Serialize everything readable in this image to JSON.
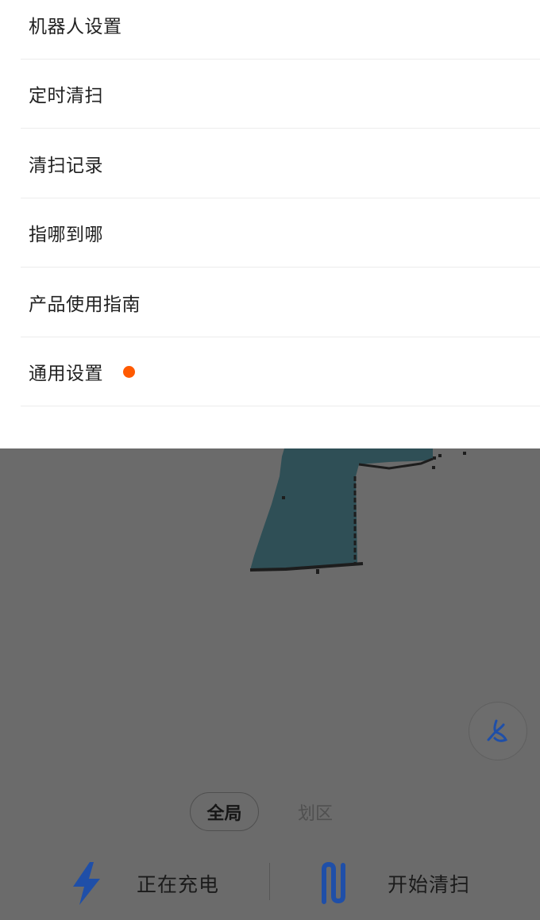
{
  "menu": {
    "items": [
      {
        "label": "机器人设置"
      },
      {
        "label": "定时清扫"
      },
      {
        "label": "清扫记录"
      },
      {
        "label": "指哪到哪"
      },
      {
        "label": "产品使用指南"
      },
      {
        "label": "通用设置",
        "badge_color": "#ff5a00"
      }
    ]
  },
  "modes": {
    "global": "全局",
    "zone": "划区"
  },
  "actions": {
    "charging": {
      "label": "正在充电",
      "icon": "lightning-icon"
    },
    "start": {
      "label": "开始清扫",
      "icon": "sweep-path-icon"
    }
  },
  "fan_button": {
    "icon": "fan-icon"
  },
  "colors": {
    "accent_blue": "#1f4fa8",
    "badge": "#ff5a00",
    "map_fill": "#2f4f56",
    "overlay": "#6b6b6b"
  }
}
